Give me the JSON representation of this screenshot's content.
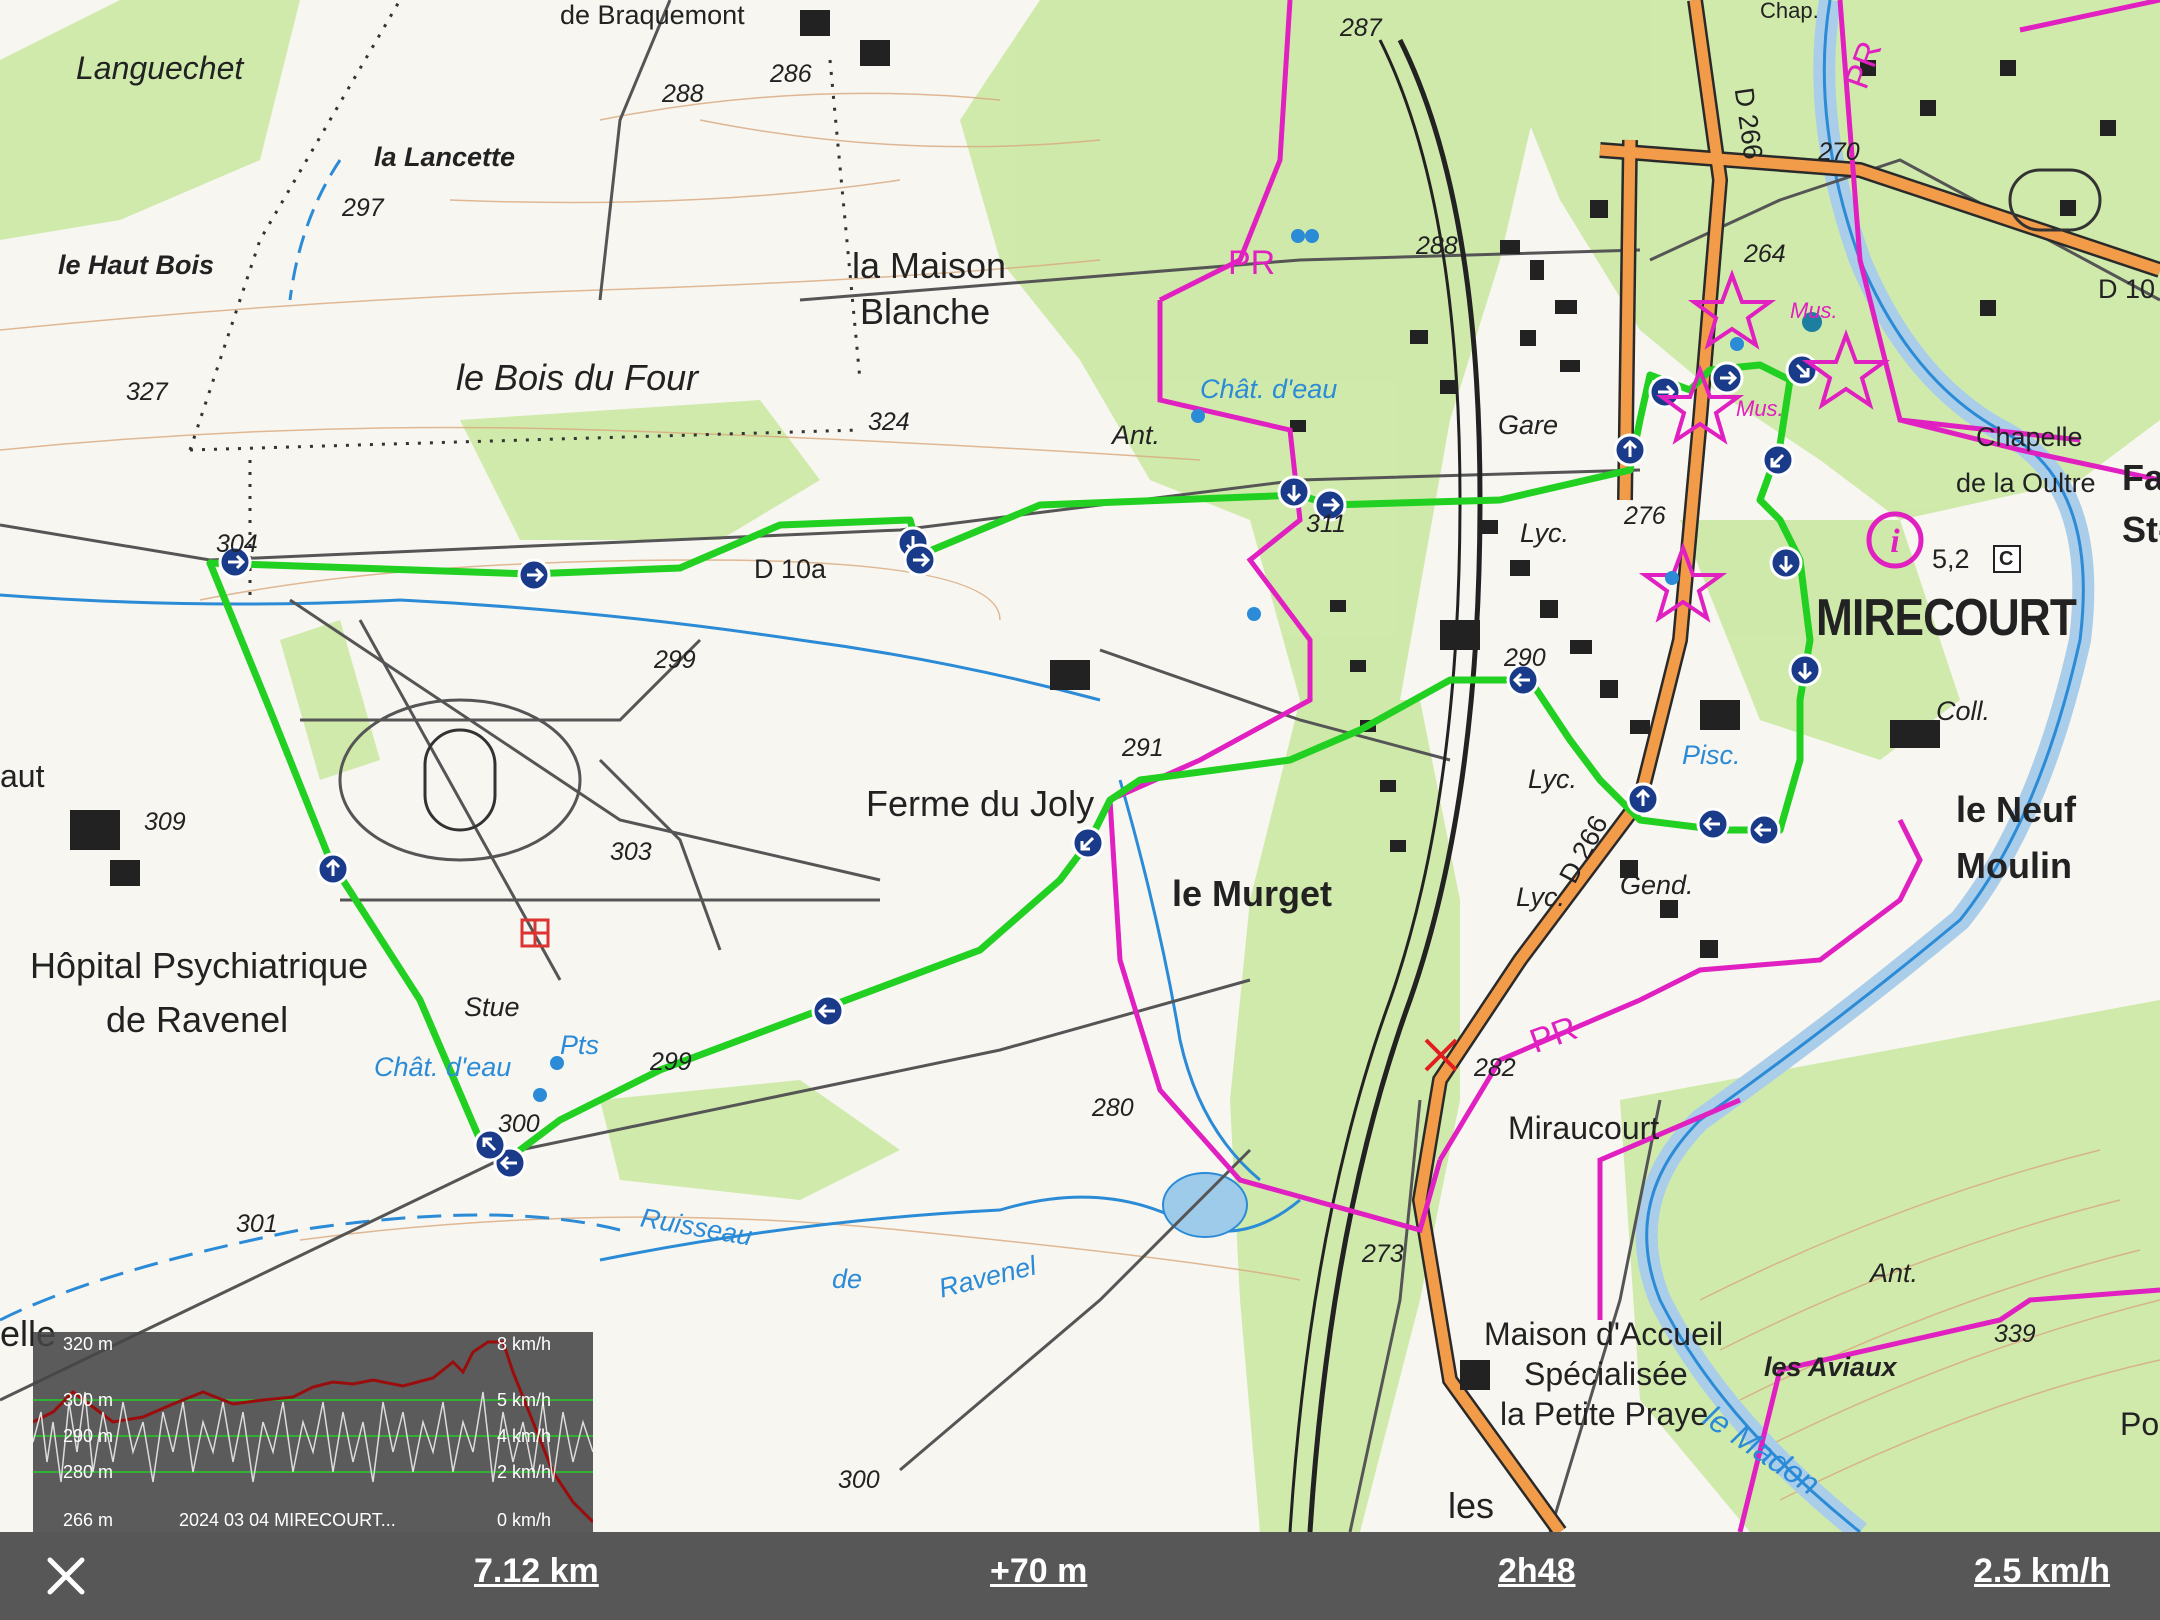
{
  "map": {
    "places": [
      {
        "id": "languechet",
        "text": "Languechet"
      },
      {
        "id": "braquemont",
        "text": "de Braquemont"
      },
      {
        "id": "la-lancette",
        "text": "la Lancette"
      },
      {
        "id": "haut-bois",
        "text": "le Haut Bois"
      },
      {
        "id": "maison-blanche-1",
        "text": "la Maison"
      },
      {
        "id": "maison-blanche-2",
        "text": "Blanche"
      },
      {
        "id": "bois-du-four",
        "text": "le Bois du Four"
      },
      {
        "id": "chat-eau-1",
        "text": "Chât. d'eau"
      },
      {
        "id": "ant-1",
        "text": "Ant."
      },
      {
        "id": "gare",
        "text": "Gare"
      },
      {
        "id": "chapelle-1",
        "text": "Chapelle"
      },
      {
        "id": "chapelle-2",
        "text": "de la Oultre"
      },
      {
        "id": "fa",
        "text": "Fa"
      },
      {
        "id": "st",
        "text": "St-"
      },
      {
        "id": "mirecourt",
        "text": "MIRECOURT"
      },
      {
        "id": "lyc-1",
        "text": "Lyc."
      },
      {
        "id": "coll",
        "text": "Coll."
      },
      {
        "id": "pisc",
        "text": "Pisc."
      },
      {
        "id": "lyc-2",
        "text": "Lyc."
      },
      {
        "id": "lyc-3",
        "text": "Lyc."
      },
      {
        "id": "gend",
        "text": "Gend."
      },
      {
        "id": "neuf-moulin-1",
        "text": "le Neuf"
      },
      {
        "id": "neuf-moulin-2",
        "text": "Moulin"
      },
      {
        "id": "ferme-joly",
        "text": "Ferme du Joly"
      },
      {
        "id": "le-murget",
        "text": "le Murget"
      },
      {
        "id": "hopital-1",
        "text": "Hôpital Psychiatrique"
      },
      {
        "id": "hopital-2",
        "text": "de Ravenel"
      },
      {
        "id": "aut",
        "text": "aut"
      },
      {
        "id": "stue",
        "text": "Stue"
      },
      {
        "id": "chat-eau-2",
        "text": "Chât. d'eau"
      },
      {
        "id": "pts",
        "text": "Pts"
      },
      {
        "id": "miraucourt",
        "text": "Miraucourt"
      },
      {
        "id": "ruisseau",
        "text": "Ruisseau"
      },
      {
        "id": "de",
        "text": "de"
      },
      {
        "id": "ravenel",
        "text": "Ravenel"
      },
      {
        "id": "ant-2",
        "text": "Ant."
      },
      {
        "id": "les-aviaux",
        "text": "les Aviaux"
      },
      {
        "id": "maison-accueil-1",
        "text": "Maison d'Accueil"
      },
      {
        "id": "maison-accueil-2",
        "text": "Spécialisée"
      },
      {
        "id": "petite-praye",
        "text": "la Petite Praye"
      },
      {
        "id": "le-madon",
        "text": "le Madon"
      },
      {
        "id": "les",
        "text": "les"
      },
      {
        "id": "elle",
        "text": "elle"
      },
      {
        "id": "po",
        "text": "Po"
      },
      {
        "id": "chap",
        "text": "Chap."
      },
      {
        "id": "mus-1",
        "text": "Mus."
      },
      {
        "id": "mus-2",
        "text": "Mus."
      }
    ],
    "roads": {
      "d10a": "D 10a",
      "d266_1": "D 266",
      "d266_2": "D 266",
      "d10": "D 10"
    },
    "altitudes": [
      "288",
      "286",
      "287",
      "297",
      "327",
      "324",
      "304",
      "299",
      "311",
      "270",
      "264",
      "276",
      "290",
      "291",
      "303",
      "299",
      "300",
      "280",
      "282",
      "273",
      "301",
      "300",
      "339",
      "309",
      "288"
    ],
    "pr": [
      "PR",
      "PR",
      "PR"
    ],
    "info_badge": {
      "value": "5,2",
      "letter": "C"
    }
  },
  "profile": {
    "alt_labels": [
      "320 m",
      "300 m",
      "290 m",
      "280 m",
      "266 m"
    ],
    "speed_labels": [
      "8 km/h",
      "5 km/h",
      "4 km/h",
      "2 km/h",
      "0 km/h"
    ],
    "track_name": "2024 03 04 MIRECOURT..."
  },
  "stats": {
    "distance": "7.12 km",
    "elevation": "+70 m",
    "duration": "2h48",
    "speed": "2.5 km/h"
  },
  "colors": {
    "track": "#22d022",
    "trail": "#e020c0",
    "road_main": "#f29c4a",
    "water": "#2b8bd6",
    "forest": "#cbe8a6",
    "bar": "#575757"
  }
}
